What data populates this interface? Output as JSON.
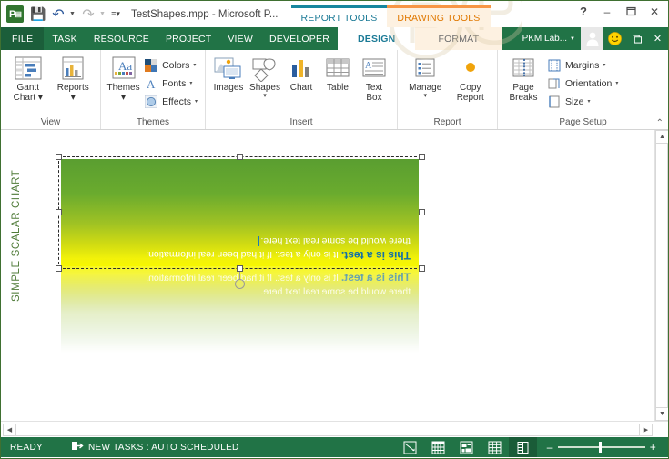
{
  "titlebar": {
    "app_icon": "project-logo-icon",
    "document_title": "TestShapes.mpp - Microsoft P...",
    "quick_access": [
      {
        "name": "save-icon",
        "label": "Save"
      },
      {
        "name": "undo-icon",
        "label": "Undo"
      },
      {
        "name": "redo-icon",
        "label": "Redo"
      },
      {
        "name": "customize-qat-icon",
        "label": "Customize Quick Access Toolbar"
      }
    ],
    "context_tabs": [
      {
        "label": "REPORT TOOLS",
        "accent": "#17869e"
      },
      {
        "label": "DRAWING TOOLS",
        "accent": "#f79646"
      }
    ],
    "window_controls": [
      {
        "name": "help-button",
        "glyph": "?"
      },
      {
        "name": "minimize-button",
        "glyph": "–"
      },
      {
        "name": "restore-button",
        "glyph": "❐"
      },
      {
        "name": "close-button",
        "glyph": "✕"
      }
    ]
  },
  "tabbar": {
    "file_label": "FILE",
    "tabs": [
      {
        "label": "TASK",
        "active": false
      },
      {
        "label": "RESOURCE",
        "active": false
      },
      {
        "label": "PROJECT",
        "active": false
      },
      {
        "label": "VIEW",
        "active": false
      },
      {
        "label": "DEVELOPER",
        "active": false
      },
      {
        "label": "DESIGN",
        "active": true
      },
      {
        "label": "FORMAT",
        "active": false
      }
    ],
    "account_name": "PKM Lab...",
    "right_buttons": [
      {
        "name": "ribbon-display-options-button",
        "glyph": "❐"
      },
      {
        "name": "close-document-button",
        "glyph": "✕"
      }
    ]
  },
  "ribbon": {
    "groups": [
      {
        "label": "View",
        "big_buttons": [
          {
            "name": "gantt-chart-button",
            "line1": "Gantt",
            "line2": "Chart ▾",
            "icon": "gantt-chart-icon"
          },
          {
            "name": "reports-button",
            "line1": "Reports",
            "line2": "▾",
            "icon": "reports-icon"
          }
        ]
      },
      {
        "label": "Themes",
        "big_buttons": [
          {
            "name": "themes-button",
            "line1": "Themes",
            "line2": "▾",
            "icon": "themes-icon"
          }
        ],
        "small_buttons": [
          {
            "name": "colors-button",
            "label": "Colors",
            "icon": "colors-swatch-icon",
            "caret": "▾"
          },
          {
            "name": "fonts-button",
            "label": "Fonts",
            "icon": "fonts-a-icon",
            "caret": "▾"
          },
          {
            "name": "effects-button",
            "label": "Effects",
            "icon": "effects-circle-icon",
            "caret": "▾"
          }
        ]
      },
      {
        "label": "Insert",
        "big_buttons": [
          {
            "name": "images-button",
            "line1": "Images",
            "line2": "",
            "icon": "images-icon"
          },
          {
            "name": "shapes-button",
            "line1": "Shapes",
            "line2": "▾",
            "icon": "shapes-icon"
          },
          {
            "name": "chart-button",
            "line1": "Chart",
            "line2": "",
            "icon": "chart-bar-icon"
          },
          {
            "name": "table-button",
            "line1": "Table",
            "line2": "",
            "icon": "table-grid-icon"
          },
          {
            "name": "text-box-button",
            "line1": "Text",
            "line2": "Box",
            "icon": "text-box-icon"
          }
        ]
      },
      {
        "label": "Report",
        "big_buttons": [
          {
            "name": "manage-button",
            "line1": "Manage",
            "line2": "▾",
            "icon": "manage-list-icon"
          },
          {
            "name": "copy-report-button",
            "line1": "Copy",
            "line2": "Report",
            "icon": "copy-report-icon"
          }
        ]
      },
      {
        "label": "Page Setup",
        "big_buttons": [
          {
            "name": "page-breaks-button",
            "line1": "Page",
            "line2": "Breaks",
            "icon": "page-breaks-icon"
          }
        ],
        "small_buttons": [
          {
            "name": "margins-button",
            "label": "Margins",
            "icon": "margins-icon",
            "caret": "▾"
          },
          {
            "name": "orientation-button",
            "label": "Orientation",
            "icon": "orientation-icon",
            "caret": "▾"
          },
          {
            "name": "size-button",
            "label": "Size",
            "icon": "size-icon",
            "caret": "▾"
          }
        ]
      }
    ],
    "collapse_glyph": "⌃"
  },
  "canvas": {
    "report_title": "SIMPLE SCALAR CHART",
    "shape": {
      "name": "rounded-rectangle-shape",
      "rotation_degrees": 180,
      "gradient_from": "#5a9e30",
      "gradient_to": "#f7f700",
      "text_line1_bold": "This is a test.",
      "text_line1_rest": " It is only a test. If it had been real information,",
      "text_line2": "there would be some real text here.",
      "bold_color": "#0f6fa8",
      "text_color": "#ffffff",
      "has_reflection": true
    },
    "selection": {
      "handle_count": 8,
      "rotation_handle": "rotate-handle"
    }
  },
  "scrollbars": {
    "vertical": {
      "up_glyph": "▲",
      "down_glyph": "▼"
    },
    "horizontal": {
      "left_glyph": "◀",
      "right_glyph": "▶"
    }
  },
  "statusbar": {
    "ready_label": "READY",
    "new_tasks_label": "NEW TASKS : AUTO SCHEDULED",
    "new_tasks_icon": "auto-schedule-icon",
    "view_buttons": [
      {
        "name": "gantt-chart-view-button",
        "icon": "gantt-view-icon",
        "active": false
      },
      {
        "name": "task-usage-view-button",
        "icon": "task-usage-icon",
        "active": false
      },
      {
        "name": "team-planner-view-button",
        "icon": "team-planner-icon",
        "active": false
      },
      {
        "name": "resource-sheet-view-button",
        "icon": "resource-sheet-icon",
        "active": false
      },
      {
        "name": "report-view-button",
        "icon": "report-view-icon",
        "active": true
      }
    ],
    "zoom": {
      "minus": "–",
      "plus": "+",
      "thumb_position_percent": 47
    }
  }
}
